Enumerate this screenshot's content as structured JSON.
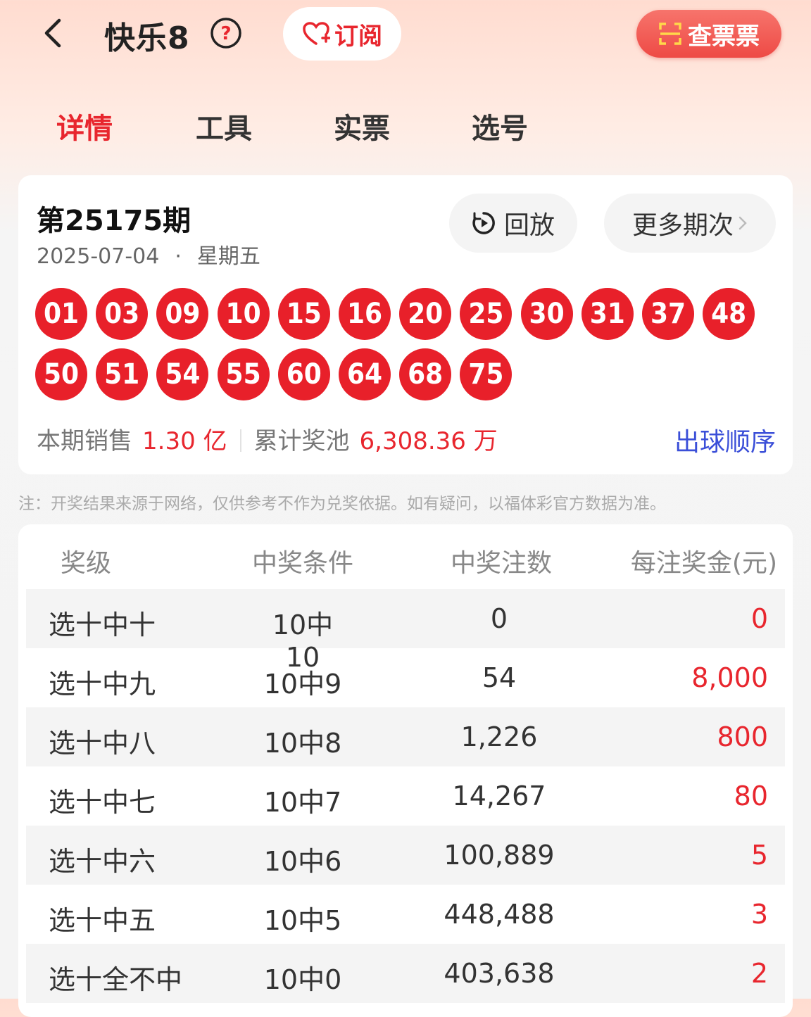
{
  "header": {
    "title": "快乐8",
    "subscribe_label": "订阅",
    "check_ticket_label": "查票票"
  },
  "tabs": [
    {
      "label": "详情",
      "active": true
    },
    {
      "label": "工具",
      "active": false
    },
    {
      "label": "实票",
      "active": false
    },
    {
      "label": "选号",
      "active": false
    }
  ],
  "draw": {
    "issue": "第25175期",
    "date": "2025-07-04",
    "weekday": "星期五",
    "replay_label": "回放",
    "more_label": "更多期次",
    "numbers": [
      "01",
      "03",
      "09",
      "10",
      "15",
      "16",
      "20",
      "25",
      "30",
      "31",
      "37",
      "48",
      "50",
      "51",
      "54",
      "55",
      "60",
      "64",
      "68",
      "75"
    ],
    "sales_label": "本期销售",
    "sales_value": "1.30 亿",
    "pool_label": "累计奖池",
    "pool_value": "6,308.36 万",
    "order_link": "出球顺序"
  },
  "note": "注：开奖结果来源于网络，仅供参考不作为兑奖依据。如有疑问，以福体彩官方数据为准。",
  "prize_table": {
    "headers": [
      "奖级",
      "中奖条件",
      "中奖注数",
      "每注奖金(元)"
    ],
    "rows": [
      {
        "level": "选十中十",
        "cond": "10中10",
        "count": "0",
        "amount": "0"
      },
      {
        "level": "选十中九",
        "cond": "10中9",
        "count": "54",
        "amount": "8,000"
      },
      {
        "level": "选十中八",
        "cond": "10中8",
        "count": "1,226",
        "amount": "800"
      },
      {
        "level": "选十中七",
        "cond": "10中7",
        "count": "14,267",
        "amount": "80"
      },
      {
        "level": "选十中六",
        "cond": "10中6",
        "count": "100,889",
        "amount": "5"
      },
      {
        "level": "选十中五",
        "cond": "10中5",
        "count": "448,488",
        "amount": "3"
      },
      {
        "level": "选十全不中",
        "cond": "10中0",
        "count": "403,638",
        "amount": "2"
      }
    ]
  },
  "colors": {
    "accent": "#e8262e",
    "link": "#3b4fd8",
    "ball": "#e8202a"
  }
}
